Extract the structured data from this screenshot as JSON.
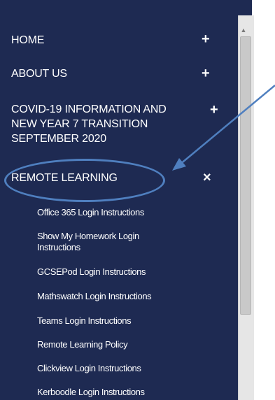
{
  "nav": {
    "items": [
      {
        "label": "HOME",
        "toggle": "+"
      },
      {
        "label": "ABOUT US",
        "toggle": "+"
      },
      {
        "label_lines": [
          "COVID-19 INFORMATION AND",
          "NEW YEAR 7 TRANSITION",
          "SEPTEMBER 2020"
        ],
        "toggle": "+"
      },
      {
        "label": "REMOTE LEARNING",
        "toggle": "×",
        "expanded": true
      }
    ],
    "subitems": [
      "Office 365 Login Instructions",
      "Show My Homework Login Instructions",
      "GCSEPod Login Instructions",
      "Mathswatch Login Instructions",
      "Teams Login Instructions",
      "Remote Learning Policy",
      "Clickview Login Instructions",
      "Kerboodle Login Instructions"
    ]
  },
  "colors": {
    "sidebar_bg": "#1e2a52",
    "annotation": "#4f7fbf",
    "scrollbar_track": "#e6e6e6",
    "scrollbar_thumb": "#c9c9c9"
  },
  "annotation": {
    "shape": "ellipse",
    "target": "REMOTE LEARNING",
    "arrow": "arrow-pointing-to-remote-learning"
  },
  "scrollbar": {
    "up_icon": "▲"
  }
}
